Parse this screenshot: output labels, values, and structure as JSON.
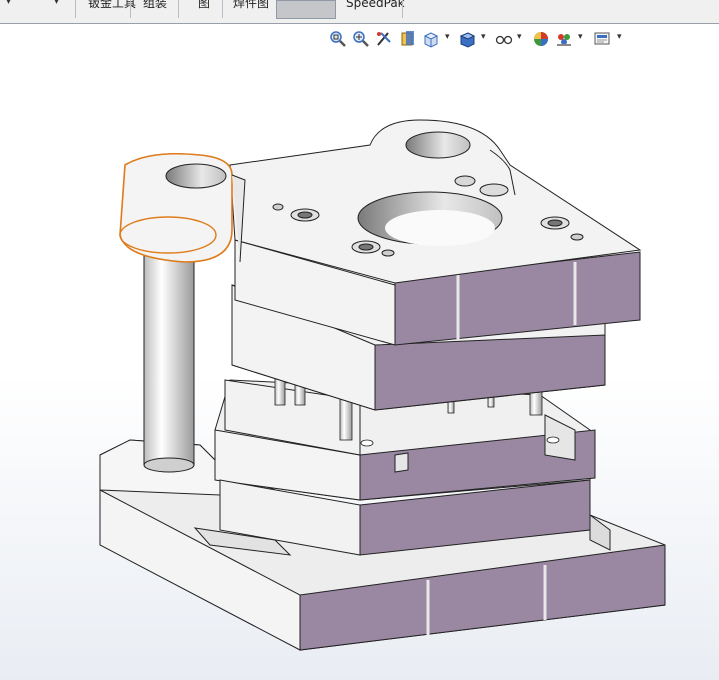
{
  "toolbar": {
    "tabs": [
      {
        "label": "钣金工具"
      },
      {
        "label": "组装"
      },
      {
        "label": "图"
      },
      {
        "label": "焊件图"
      },
      {
        "label": ""
      },
      {
        "label": "SpeedPak"
      }
    ],
    "carets": [
      "▾",
      "▾"
    ]
  },
  "view_toolbar": {
    "icons": [
      "zoom-to-fit-icon",
      "zoom-to-area-icon",
      "previous-view-icon",
      "section-view-icon",
      "view-orientation-icon",
      "display-style-icon",
      "hide-show-items-icon",
      "edit-appearance-icon",
      "apply-scene-icon",
      "view-settings-icon"
    ],
    "caret": "▾",
    "colors": {
      "icon_blue": "#3a6fc4",
      "icon_green": "#3c9a3c",
      "icon_red": "#d23a2a"
    }
  },
  "model": {
    "name": "stamping-die-assembly",
    "colors": {
      "face_light": "#f4f4f4",
      "face_side": "#e4e4e4",
      "face_purple": "#9a88a2",
      "edge": "#222222",
      "selection": "#e07b1a"
    }
  }
}
